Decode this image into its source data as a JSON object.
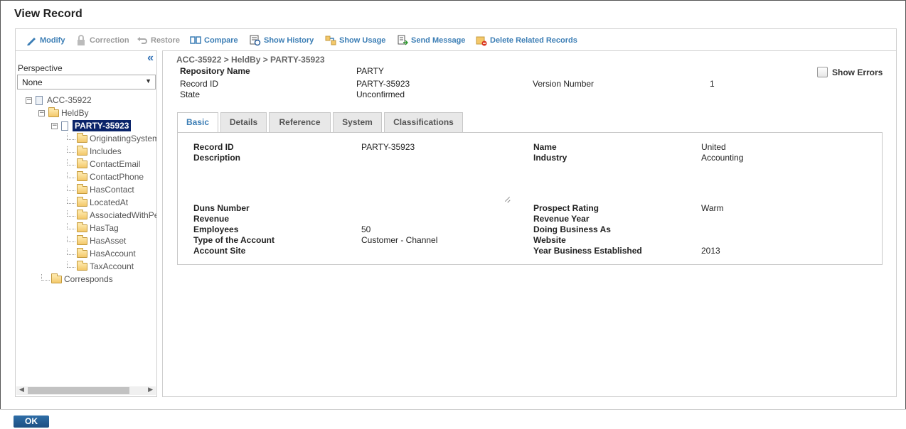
{
  "window": {
    "title": "View Record"
  },
  "toolbar": {
    "modify": "Modify",
    "correction": "Correction",
    "restore": "Restore",
    "compare": "Compare",
    "show_history": "Show History",
    "show_usage": "Show Usage",
    "send_message": "Send Message",
    "delete_related": "Delete Related Records"
  },
  "sidebar": {
    "perspective_label": "Perspective",
    "perspective_value": "None",
    "tree": {
      "root": "ACC-35922",
      "heldby": "HeldBy",
      "party": "PARTY-35923",
      "children": [
        "OriginatingSystem",
        "Includes",
        "ContactEmail",
        "ContactPhone",
        "HasContact",
        "LocatedAt",
        "AssociatedWithPerson",
        "HasTag",
        "HasAsset",
        "HasAccount",
        "TaxAccount"
      ],
      "corresponds": "Corresponds"
    }
  },
  "record": {
    "breadcrumb": "ACC-35922 > HeldBy > PARTY-35923",
    "repository_name_label": "Repository Name",
    "repository_name_value": "PARTY",
    "record_id_label": "Record ID",
    "record_id_value": "PARTY-35923",
    "state_label": "State",
    "state_value": "Unconfirmed",
    "version_label": "Version Number",
    "version_value": "1",
    "show_errors": "Show Errors"
  },
  "tabs": [
    "Basic",
    "Details",
    "Reference",
    "System",
    "Classifications"
  ],
  "basic": {
    "record_id_label": "Record ID",
    "record_id_value": "PARTY-35923",
    "description_label": "Description",
    "name_label": "Name",
    "name_value": "United",
    "industry_label": "Industry",
    "industry_value": "Accounting",
    "duns_label": "Duns Number",
    "revenue_label": "Revenue",
    "employees_label": "Employees",
    "employees_value": "50",
    "type_label": "Type of the Account",
    "type_value": "Customer - Channel",
    "site_label": "Account Site",
    "prospect_label": "Prospect Rating",
    "prospect_value": "Warm",
    "revenue_year_label": "Revenue Year",
    "dba_label": "Doing Business As",
    "website_label": "Website",
    "year_est_label": "Year Business Established",
    "year_est_value": "2013"
  },
  "footer": {
    "ok": "OK"
  },
  "colors": {
    "accent": "#3c7eb5",
    "selected_node": "#0a246a",
    "ok_button": "#2f6ea7"
  }
}
